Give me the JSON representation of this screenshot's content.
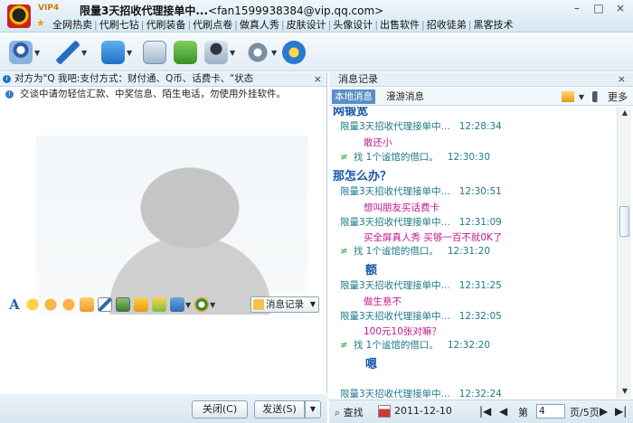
{
  "window": {
    "vip_badge": "VIP4",
    "title": "限量3天招收代理接单中...",
    "email": "<fan1599938384@vip.qq.com>",
    "links": [
      "全网热卖",
      "代刷七钻",
      "代刷装备",
      "代刷点卷",
      "做真人秀",
      "皮肤设计",
      "头像设计",
      "出售软件",
      "招收徒弟",
      "黑客技术"
    ],
    "controls": {
      "minimize": "–",
      "maximize": "□",
      "close": "×"
    }
  },
  "toolbar": {
    "icons": [
      "webcam-icon",
      "microphone-icon",
      "folder-icon",
      "mail-icon",
      "sms-icon",
      "user-card-icon",
      "settings-icon",
      "qzone-icon"
    ]
  },
  "chat": {
    "notice": "对方为\"Q 我吧:支付方式：财付通、Q币、话费卡、\"状态",
    "warning": "交谈中请勿轻信汇款、中奖信息、陌生电话，勿使用外挂软件。",
    "message_record_button": "消息记录",
    "close_button": "关闭(C)",
    "send_button": "发送(S)"
  },
  "history": {
    "header": "消息记录",
    "tabs": [
      "本地消息",
      "漫游消息"
    ],
    "more": "更多",
    "rows": [
      {
        "type": "big",
        "text": "网锻宽"
      },
      {
        "type": "hdr",
        "sender": "限量3天招收代理接单中...",
        "time": "12:28:34"
      },
      {
        "type": "msg",
        "text": "敢还小"
      },
      {
        "type": "sys",
        "text": "找 1个谧馆的借口。",
        "time": "12:30:30"
      },
      {
        "type": "big",
        "text": "那怎么办？"
      },
      {
        "type": "hdr",
        "sender": "限量3天招收代理接单中...",
        "time": "12:30:51"
      },
      {
        "type": "msg",
        "text": "想叫朋友买话费卡"
      },
      {
        "type": "hdr",
        "sender": "限量3天招收代理接单中...",
        "time": "12:31:09"
      },
      {
        "type": "msg",
        "text": "买全屏真人秀   买够一百不就0K了"
      },
      {
        "type": "sys",
        "text": "找 1个谧馆的借口。",
        "time": "12:31:20"
      },
      {
        "type": "big",
        "text": "额"
      },
      {
        "type": "hdr",
        "sender": "限量3天招收代理接单中...",
        "time": "12:31:25"
      },
      {
        "type": "msg",
        "text": "做生意不"
      },
      {
        "type": "hdr",
        "sender": "限量3天招收代理接单中...",
        "time": "12:32:05"
      },
      {
        "type": "msg",
        "text": "100元10张对嘛？"
      },
      {
        "type": "sys",
        "text": "找 1个谧馆的借口。",
        "time": "12:32:20"
      },
      {
        "type": "big",
        "text": "嗯"
      },
      {
        "type": "hdr",
        "sender": "限量3天招收代理接单中...",
        "time": "12:32:24"
      }
    ],
    "footer": {
      "search": "查找",
      "date": "2011-12-10",
      "page_label": "第",
      "page_value": "4",
      "page_total": "页/5页"
    }
  }
}
